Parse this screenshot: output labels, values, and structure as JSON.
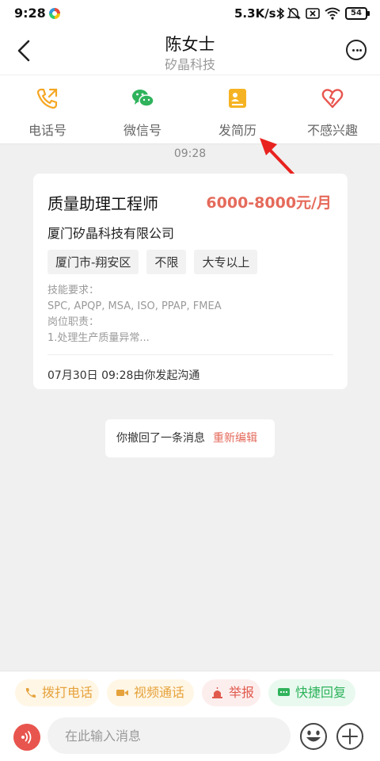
{
  "status_bar": {
    "time": "9:28",
    "network_speed": "5.3K/s",
    "battery": "54",
    "icons": [
      "app-notification-icon",
      "bluetooth-icon",
      "mute-icon",
      "sim-icon",
      "wifi-icon",
      "battery-icon"
    ]
  },
  "header": {
    "name": "陈女士",
    "company": "矽晶科技",
    "icons": [
      "back-arrow-icon",
      "more-icon"
    ]
  },
  "actions": [
    {
      "label": "电话号",
      "icon": "phone-icon",
      "color": "#f5a623"
    },
    {
      "label": "微信号",
      "icon": "wechat-icon",
      "color": "#2fb35c"
    },
    {
      "label": "发简历",
      "icon": "resume-icon",
      "color": "#f5a623"
    },
    {
      "label": "不感兴趣",
      "icon": "broken-heart-icon",
      "color": "#e8554e"
    }
  ],
  "chat": {
    "timestamp": "09:28",
    "job_card": {
      "title": "质量助理工程师",
      "salary": "6000-8000元/月",
      "company": "厦门矽晶科技有限公司",
      "tags": [
        "厦门市-翔安区",
        "不限",
        "大专以上"
      ],
      "requirements": [
        "技能要求：",
        "SPC, APQP, MSA, ISO, PPAP, FMEA",
        "岗位职责：",
        "1.处理生产质量异常..."
      ],
      "footer": "07月30日 09:28由你发起沟通"
    },
    "recall_notice": {
      "message": "你撤回了一条消息",
      "action": "重新编辑"
    }
  },
  "bottom": {
    "quick_actions": [
      {
        "label": "拨打电话",
        "icon": "phone-icon",
        "color": "#e6a23c"
      },
      {
        "label": "视频通话",
        "icon": "video-icon",
        "color": "#e6a23c"
      },
      {
        "label": "举报",
        "icon": "alarm-icon",
        "color": "#e05a4e"
      },
      {
        "label": "快捷回复",
        "icon": "quick-reply-icon",
        "color": "#2fb35c"
      }
    ],
    "input_placeholder": "在此输入消息",
    "icons": [
      "voice-icon",
      "emoji-icon",
      "plus-icon"
    ]
  },
  "accent_color": "#e56a5b"
}
